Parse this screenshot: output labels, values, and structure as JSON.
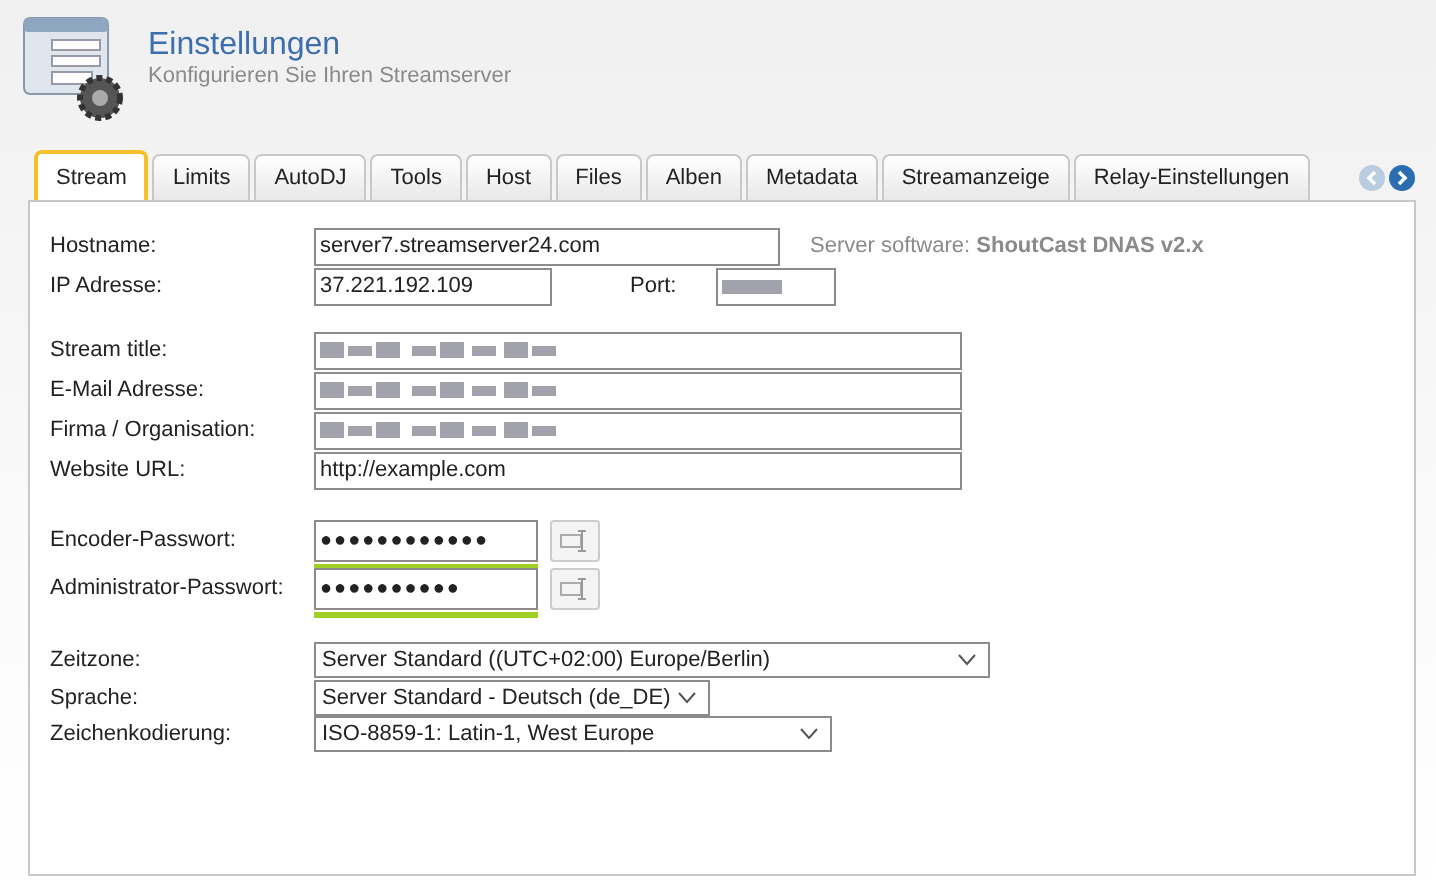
{
  "header": {
    "title": "Einstellungen",
    "subtitle": "Konfigurieren Sie Ihren Streamserver"
  },
  "tabs": [
    {
      "label": "Stream",
      "selected": true
    },
    {
      "label": "Limits",
      "selected": false
    },
    {
      "label": "AutoDJ",
      "selected": false
    },
    {
      "label": "Tools",
      "selected": false
    },
    {
      "label": "Host",
      "selected": false
    },
    {
      "label": "Files",
      "selected": false
    },
    {
      "label": "Alben",
      "selected": false
    },
    {
      "label": "Metadata",
      "selected": false
    },
    {
      "label": "Streamanzeige",
      "selected": false
    },
    {
      "label": "Relay-Einstellungen",
      "selected": false
    }
  ],
  "server": {
    "hostname_label": "Hostname:",
    "hostname": "server7.streamserver24.com",
    "ip_label": "IP Adresse:",
    "ip": "37.221.192.109",
    "software_label": "Server software:",
    "software": "ShoutCast DNAS v2.x",
    "port_label": "Port:",
    "port_obscured": true
  },
  "stream_fields": [
    {
      "label": "Stream title:",
      "kind": "obscured"
    },
    {
      "label": "E-Mail Adresse:",
      "kind": "obscured"
    },
    {
      "label": "Firma / Organisation:",
      "kind": "obscured"
    },
    {
      "label": "Website URL:",
      "kind": "text",
      "value": "http://example.com"
    }
  ],
  "passwords": [
    {
      "label": "Encoder-Passwort:",
      "value": "●●●●●●●●●●●●",
      "level": 1
    },
    {
      "label": "Administrator-Passwort:",
      "value": "●●●●●●●●●●",
      "level": 1
    }
  ],
  "selects": [
    {
      "label": "Zeitzone:",
      "value": "Server Standard ((UTC+02:00) Europe/Berlin)"
    },
    {
      "label": "Sprache:",
      "value": "Server Standard - Deutsch (de_DE)"
    },
    {
      "label": "Zeichenkodierung:",
      "value": "ISO-8859-1: Latin-1, West Europe"
    }
  ],
  "tab_nav": {
    "prev_disabled": true
  }
}
